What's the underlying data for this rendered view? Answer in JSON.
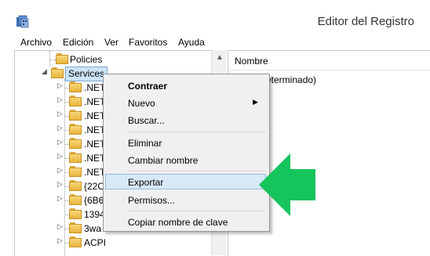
{
  "window": {
    "title": "Editor del Registro",
    "icon": "regedit-icon"
  },
  "menubar": [
    "Archivo",
    "Edición",
    "Ver",
    "Favoritos",
    "Ayuda"
  ],
  "tree": {
    "policies": "Policies",
    "services": "Services",
    "children": [
      ".NET",
      ".NET",
      ".NET",
      ".NET",
      ".NET",
      ".NET",
      ".NET",
      "{22C",
      "{6B6",
      "1394",
      "3wa",
      "ACPI"
    ]
  },
  "right_pane": {
    "column_name": "Nombre",
    "default_value": "eterminado)"
  },
  "context_menu": {
    "items": [
      "Contraer",
      "Nuevo",
      "Buscar...",
      "Eliminar",
      "Cambiar nombre",
      "Exportar",
      "Permisos...",
      "Copiar nombre de clave"
    ]
  },
  "colors": {
    "arrow": "#15c45a",
    "highlight": "#d9e8f7",
    "selected": "#cce4f7"
  }
}
